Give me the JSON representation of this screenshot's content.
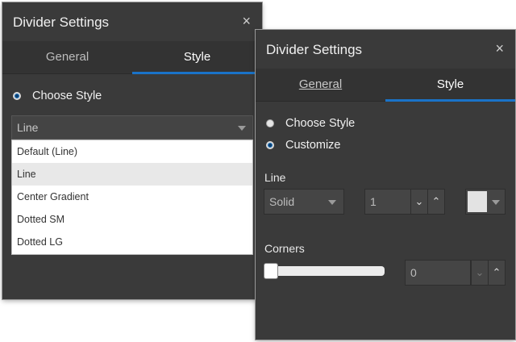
{
  "dialog1": {
    "title": "Divider Settings",
    "close_symbol": "×",
    "tabs": [
      "General",
      "Style"
    ],
    "active_tab": "Style",
    "radio_label": "Choose Style",
    "select_value": "Line",
    "dropdown_options": [
      "Default (Line)",
      "Line",
      "Center Gradient",
      "Dotted SM",
      "Dotted LG"
    ],
    "highlighted_option": "Line"
  },
  "dialog2": {
    "title": "Divider Settings",
    "close_symbol": "×",
    "tabs": [
      "General",
      "Style"
    ],
    "active_tab": "Style",
    "radio_options": [
      {
        "label": "Choose Style",
        "selected": false
      },
      {
        "label": "Customize",
        "selected": true
      }
    ],
    "line_label": "Line",
    "line_style_value": "Solid",
    "line_width_value": "1",
    "line_color": "#e3e3e3",
    "corners_label": "Corners",
    "corners_slider_value": 0,
    "corners_value": "0"
  },
  "icons": {
    "spin_down": "⌄",
    "spin_up": "⌃"
  },
  "colors": {
    "panel_bg": "#3a3a3a",
    "accent": "#1a73c8"
  }
}
